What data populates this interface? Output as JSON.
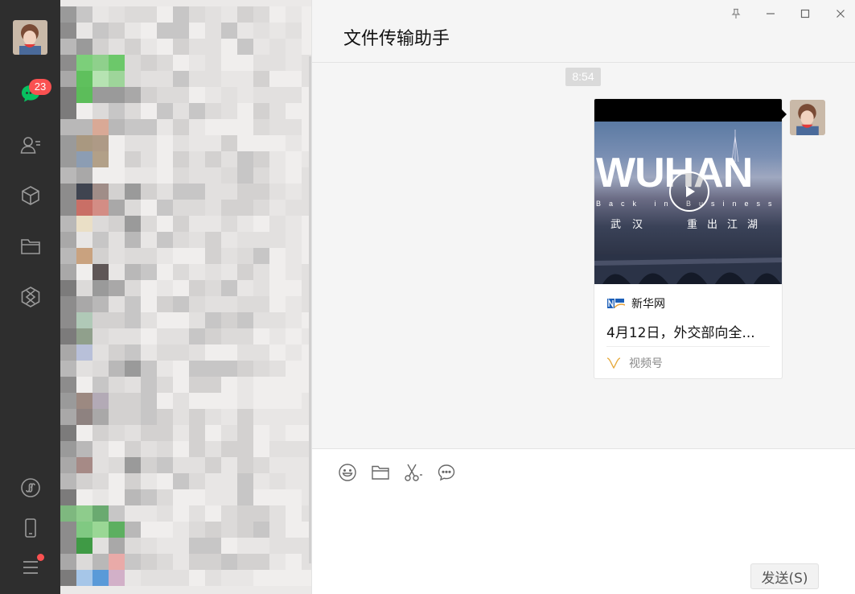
{
  "app": {
    "name": "WeChat"
  },
  "nav": {
    "unread_badge": "23",
    "items": [
      {
        "id": "chats",
        "icon": "chat-bubble-icon"
      },
      {
        "id": "contacts",
        "icon": "contacts-icon"
      },
      {
        "id": "favorites",
        "icon": "cube-icon"
      },
      {
        "id": "files",
        "icon": "folder-icon"
      },
      {
        "id": "moments",
        "icon": "aperture-icon"
      }
    ],
    "bottom_items": [
      {
        "id": "mini-programs",
        "icon": "mini-program-icon"
      },
      {
        "id": "phone",
        "icon": "phone-icon"
      },
      {
        "id": "menu",
        "icon": "hamburger-menu-icon"
      }
    ]
  },
  "chat": {
    "title": "文件传输助手",
    "timestamp": "8:54",
    "card": {
      "video_title_overlay": "WUHAN",
      "video_subtitle_overlay": "Back in Business",
      "video_cn_overlay_left": "武汉",
      "video_cn_overlay_right": "重出江湖",
      "source_name": "新华网",
      "title": "4月12日，外交部向全...",
      "footer_label": "视频号"
    }
  },
  "input": {
    "send_label": "发送(S)",
    "tools": [
      "emoji-icon",
      "folder-icon",
      "scissors-icon",
      "chat-history-icon"
    ]
  },
  "colors": {
    "nav_bg": "#2e2e2e",
    "badge": "#fa5151",
    "chat_bg": "#f5f5f5",
    "accent_green": "#07c160"
  }
}
